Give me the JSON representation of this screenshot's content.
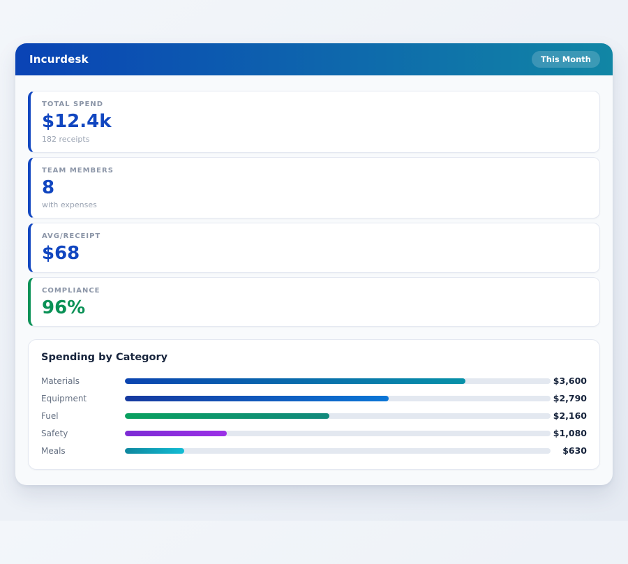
{
  "header": {
    "title": "Incurdesk",
    "badge_label": "This Month",
    "gradient_from": "#0a43b5",
    "gradient_to": "#1186a5"
  },
  "stats": [
    {
      "label": "TOTAL SPEND",
      "value": "$12.4k",
      "sub": "182 receipts",
      "accent": "#1146c0"
    },
    {
      "label": "TEAM MEMBERS",
      "value": "8",
      "sub": "with expenses",
      "accent": "#1146c0"
    },
    {
      "label": "AVG/RECEIPT",
      "value": "$68",
      "sub": "",
      "accent": "#1146c0"
    },
    {
      "label": "COMPLIANCE",
      "value": "96%",
      "sub": "",
      "accent": "#0a9156"
    }
  ],
  "chart": {
    "title": "Spending by Category",
    "track_color": "#e3e8f0",
    "rows": [
      {
        "label": "Materials",
        "value": "$3,600",
        "percent": 80,
        "from": "#0b44b0",
        "to": "#0891a8"
      },
      {
        "label": "Equipment",
        "value": "$2,790",
        "percent": 62,
        "from": "#16399f",
        "to": "#0b76d6"
      },
      {
        "label": "Fuel",
        "value": "$2,160",
        "percent": 48,
        "from": "#09a05f",
        "to": "#12897c"
      },
      {
        "label": "Safety",
        "value": "$1,080",
        "percent": 24,
        "from": "#7c2bd4",
        "to": "#9b30e6"
      },
      {
        "label": "Meals",
        "value": "$630",
        "percent": 14,
        "from": "#0e879e",
        "to": "#12bcd4"
      }
    ]
  },
  "chart_data": {
    "type": "bar",
    "title": "Spending by Category",
    "categories": [
      "Materials",
      "Equipment",
      "Fuel",
      "Safety",
      "Meals"
    ],
    "values": [
      3600,
      2790,
      2160,
      1080,
      630
    ],
    "value_labels": [
      "$3,600",
      "$2,790",
      "$2,160",
      "$1,080",
      "$630"
    ],
    "xlabel": "",
    "ylabel": "",
    "xlim": [
      0,
      4500
    ],
    "orientation": "horizontal",
    "grid": false
  }
}
